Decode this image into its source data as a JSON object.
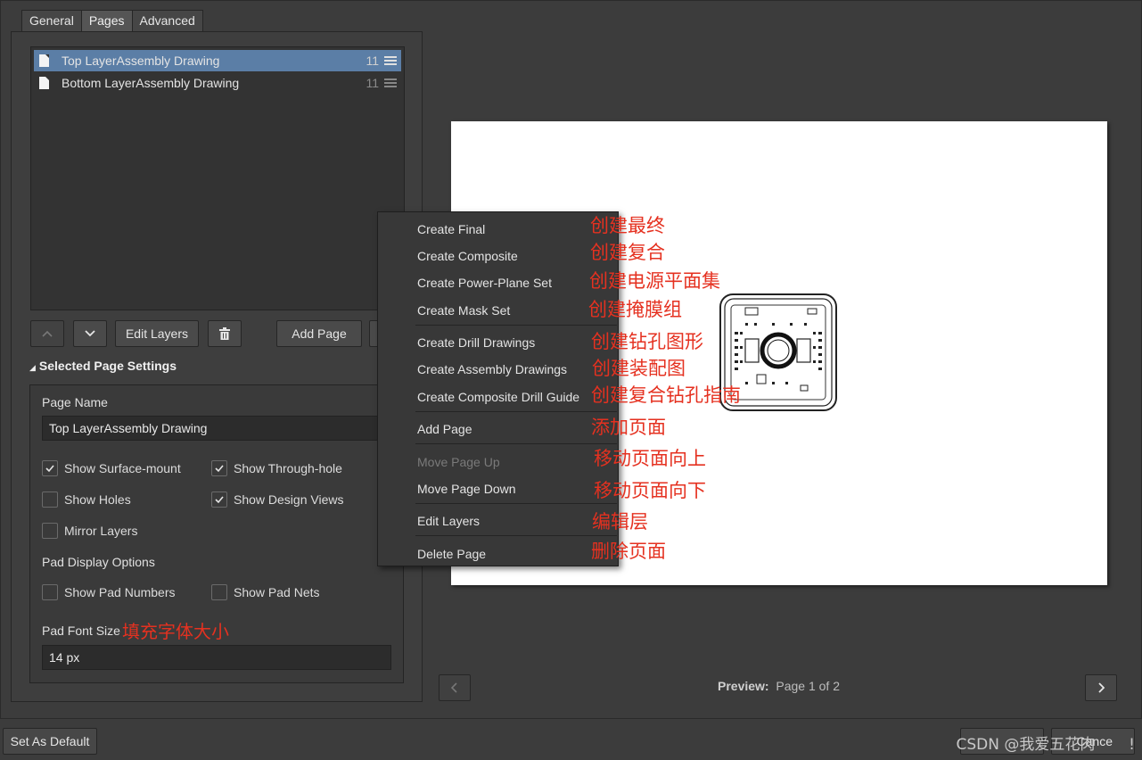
{
  "tabs": [
    "General",
    "Pages",
    "Advanced"
  ],
  "pages": [
    {
      "label": "Top LayerAssembly Drawing",
      "count": "11"
    },
    {
      "label": "Bottom LayerAssembly Drawing",
      "count": "11"
    }
  ],
  "toolbar": {
    "edit_layers": "Edit Layers",
    "add_page": "Add Page"
  },
  "selected_settings": {
    "title": "Selected Page Settings",
    "page_name_label": "Page Name",
    "page_name_value": "Top LayerAssembly Drawing",
    "show_surface_mount": "Show Surface-mount",
    "show_through_hole": "Show Through-hole",
    "show_holes": "Show Holes",
    "show_design_views": "Show Design Views",
    "mirror_layers": "Mirror Layers",
    "pad_display_options": "Pad Display Options",
    "show_pad_numbers": "Show Pad Numbers",
    "show_pad_nets": "Show Pad Nets",
    "pad_font_size_label": "Pad Font Size",
    "pad_font_size_value": "14 px",
    "pad_font_annotation": "填充字体大小"
  },
  "context_menu": [
    {
      "label": "Create Final",
      "annot": "创建最终"
    },
    {
      "label": "Create Composite",
      "annot": "创建复合"
    },
    {
      "label": "Create Power-Plane Set",
      "annot": "创建电源平面集"
    },
    {
      "label": "Create Mask Set",
      "annot": "创建掩膜组"
    },
    {
      "label": "Create Drill Drawings",
      "annot": "创建钻孔图形"
    },
    {
      "label": "Create Assembly Drawings",
      "annot": "创建装配图"
    },
    {
      "label": "Create Composite Drill Guide",
      "annot": "创建复合钻孔指南"
    },
    {
      "label": "Add Page",
      "annot": "添加页面"
    },
    {
      "label": "Move Page Up",
      "annot": "移动页面向上"
    },
    {
      "label": "Move Page Down",
      "annot": "移动页面向下"
    },
    {
      "label": "Edit Layers",
      "annot": "编辑层"
    },
    {
      "label": "Delete Page",
      "annot": "删除页面"
    }
  ],
  "preview": {
    "label": "Preview:",
    "page_info": "Page 1 of 2"
  },
  "footer": {
    "set_as_default": "Set As Default",
    "cancel_partial": "Cance",
    "watermark": "CSDN @我爱五花肉"
  }
}
